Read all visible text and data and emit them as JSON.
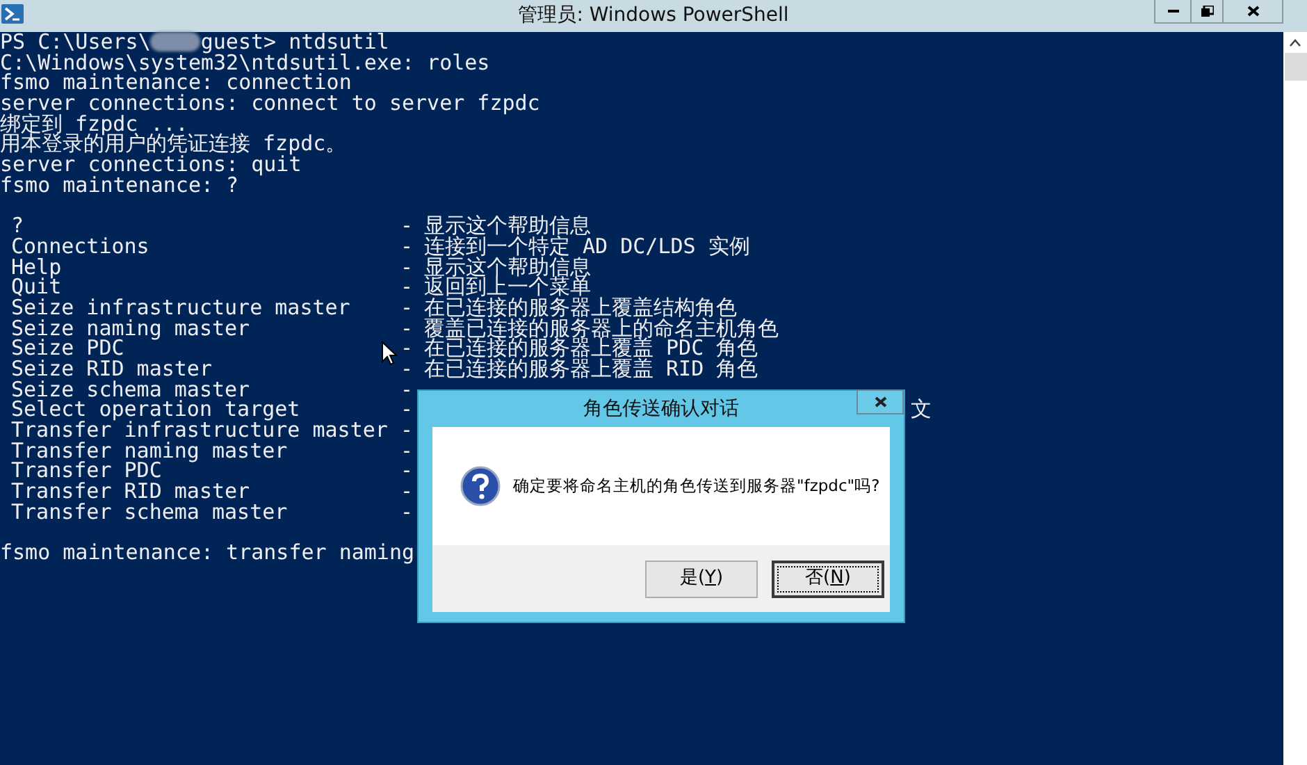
{
  "window": {
    "title": "管理员: Windows PowerShell"
  },
  "console": {
    "prompt_prefix": "PS C:\\Users\\",
    "prompt_suffix": "guest> ntdsutil",
    "lines_before": [
      "C:\\Windows\\system32\\ntdsutil.exe: roles",
      "fsmo maintenance: connection",
      "server connections: connect to server fzpdc",
      "绑定到 fzpdc ...",
      "用本登录的用户的凭证连接 fzpdc。",
      "server connections: quit",
      "fsmo maintenance: ?"
    ],
    "help_rows": [
      {
        "command": "?",
        "dash": "-",
        "description": "显示这个帮助信息"
      },
      {
        "command": "Connections",
        "dash": "-",
        "description": "连接到一个特定 AD DC/LDS 实例"
      },
      {
        "command": "Help",
        "dash": "-",
        "description": "显示这个帮助信息"
      },
      {
        "command": "Quit",
        "dash": "-",
        "description": "返回到上一个菜单"
      },
      {
        "command": "Seize infrastructure master",
        "dash": "-",
        "description": "在已连接的服务器上覆盖结构角色"
      },
      {
        "command": "Seize naming master",
        "dash": "-",
        "description": "覆盖已连接的服务器上的命名主机角色"
      },
      {
        "command": "Seize PDC",
        "dash": "-",
        "description": "在已连接的服务器上覆盖 PDC 角色"
      },
      {
        "command": "Seize RID master",
        "dash": "-",
        "description": "在已连接的服务器上覆盖 RID 角色"
      },
      {
        "command": "Seize schema master",
        "dash": "-"
      },
      {
        "command": "Select operation target",
        "dash": "-",
        "tail": "文"
      },
      {
        "command": "Transfer infrastructure master",
        "dash": "-"
      },
      {
        "command": "Transfer naming master",
        "dash": "-"
      },
      {
        "command": "Transfer PDC",
        "dash": "-"
      },
      {
        "command": "Transfer RID master",
        "dash": "-"
      },
      {
        "command": "Transfer schema master",
        "dash": "-"
      }
    ],
    "last_line": "fsmo maintenance: transfer naming"
  },
  "dialog": {
    "title": "角色传送确认对话",
    "message": "确定要将命名主机的角色传送到服务器\"fzpdc\"吗?",
    "buttons": [
      {
        "prefix": "是(",
        "accelerator": "Y",
        "suffix": ")",
        "focused": false
      },
      {
        "prefix": "否(",
        "accelerator": "N",
        "suffix": ")",
        "focused": true
      }
    ]
  }
}
